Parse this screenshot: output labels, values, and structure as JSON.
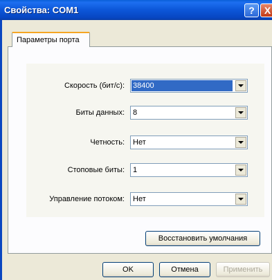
{
  "window": {
    "title": "Свойства: COM1",
    "help_label": "?",
    "close_label": "X"
  },
  "tabs": [
    {
      "label": "Параметры порта"
    }
  ],
  "fields": [
    {
      "label": "Скорость (бит/с):",
      "value": "38400",
      "selected": true
    },
    {
      "label": "Биты данных:",
      "value": "8"
    },
    {
      "label": "Четность:",
      "value": "Нет"
    },
    {
      "label": "Стоповые биты:",
      "value": "1"
    },
    {
      "label": "Управление потоком:",
      "value": "Нет"
    }
  ],
  "restore_button": {
    "label": "Восстановить умолчания"
  },
  "footer": {
    "ok_label": "OK",
    "cancel_label": "Отмена",
    "apply_label": "Применить"
  },
  "colors": {
    "titlebar": "#0c56d8",
    "selection": "#316ac5",
    "dialog_bg": "#ece9d8"
  }
}
